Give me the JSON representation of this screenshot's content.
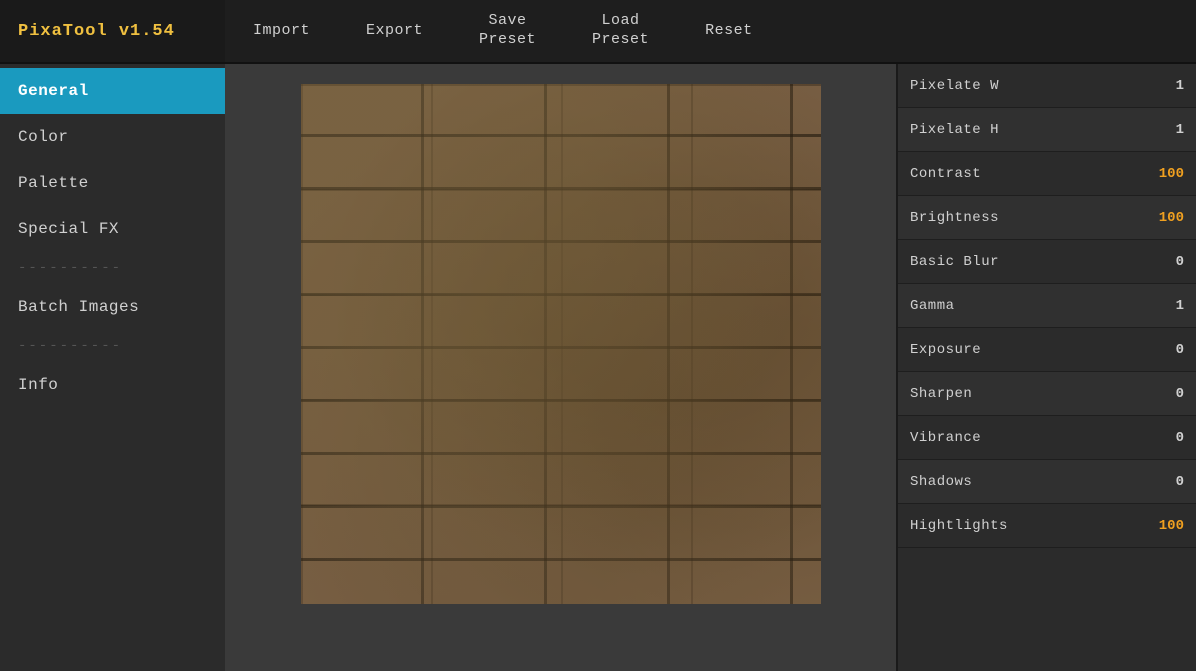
{
  "app": {
    "title": "PixaTool v1.54"
  },
  "topbar": {
    "brand": "PixaTool v1.54",
    "buttons": [
      {
        "id": "import",
        "label": "Import"
      },
      {
        "id": "export",
        "label": "Export"
      },
      {
        "id": "save-preset",
        "label": "Save\nPreset"
      },
      {
        "id": "load-preset",
        "label": "Load\nPreset"
      },
      {
        "id": "reset",
        "label": "Reset"
      }
    ]
  },
  "sidebar": {
    "items": [
      {
        "id": "general",
        "label": "General",
        "active": true
      },
      {
        "id": "color",
        "label": "Color",
        "active": false
      },
      {
        "id": "palette",
        "label": "Palette",
        "active": false
      },
      {
        "id": "special-fx",
        "label": "Special FX",
        "active": false
      }
    ],
    "divider1": "----------",
    "batch": "Batch Images",
    "divider2": "----------",
    "info": "Info"
  },
  "controls": [
    {
      "id": "pixelate-w",
      "label": "Pixelate W",
      "value": "1",
      "valueColor": "white",
      "altBg": false
    },
    {
      "id": "pixelate-h",
      "label": "Pixelate H",
      "value": "1",
      "valueColor": "white",
      "altBg": true
    },
    {
      "id": "contrast",
      "label": "Contrast",
      "value": "100",
      "valueColor": "orange",
      "altBg": false
    },
    {
      "id": "brightness",
      "label": "Brightness",
      "value": "100",
      "valueColor": "orange",
      "altBg": true
    },
    {
      "id": "basic-blur",
      "label": "Basic Blur",
      "value": "0",
      "valueColor": "white",
      "altBg": false
    },
    {
      "id": "gamma",
      "label": "Gamma",
      "value": "1",
      "valueColor": "white",
      "altBg": true
    },
    {
      "id": "exposure",
      "label": "Exposure",
      "value": "0",
      "valueColor": "white",
      "altBg": false
    },
    {
      "id": "sharpen",
      "label": "Sharpen",
      "value": "0",
      "valueColor": "white",
      "altBg": true
    },
    {
      "id": "vibrance",
      "label": "Vibrance",
      "value": "0",
      "valueColor": "white",
      "altBg": false
    },
    {
      "id": "shadows",
      "label": "Shadows",
      "value": "0",
      "valueColor": "white",
      "altBg": true
    },
    {
      "id": "highlights",
      "label": "Hightlights",
      "value": "100",
      "valueColor": "orange",
      "altBg": false
    }
  ]
}
